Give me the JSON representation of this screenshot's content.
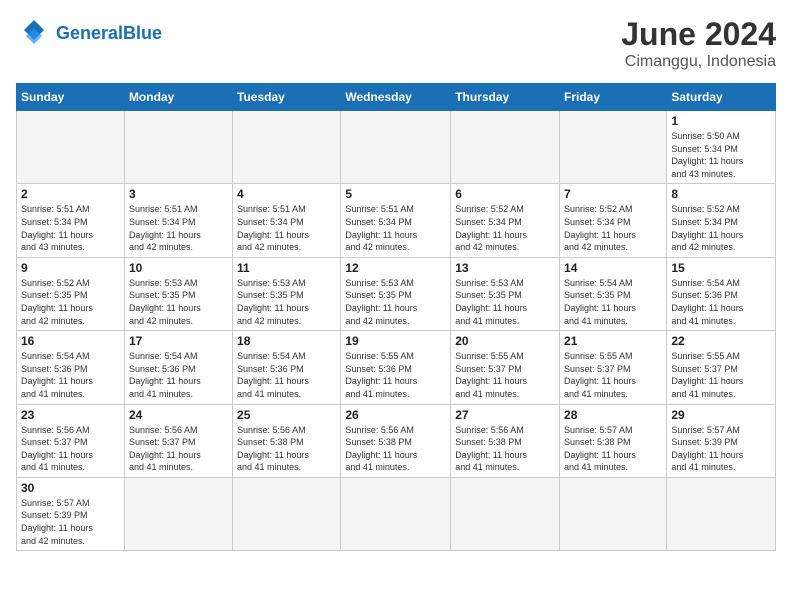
{
  "header": {
    "logo_general": "General",
    "logo_blue": "Blue",
    "title": "June 2024",
    "subtitle": "Cimanggu, Indonesia"
  },
  "weekdays": [
    "Sunday",
    "Monday",
    "Tuesday",
    "Wednesday",
    "Thursday",
    "Friday",
    "Saturday"
  ],
  "weeks": [
    [
      {
        "day": "",
        "info": ""
      },
      {
        "day": "",
        "info": ""
      },
      {
        "day": "",
        "info": ""
      },
      {
        "day": "",
        "info": ""
      },
      {
        "day": "",
        "info": ""
      },
      {
        "day": "",
        "info": ""
      },
      {
        "day": "1",
        "info": "Sunrise: 5:50 AM\nSunset: 5:34 PM\nDaylight: 11 hours\nand 43 minutes."
      }
    ],
    [
      {
        "day": "2",
        "info": "Sunrise: 5:51 AM\nSunset: 5:34 PM\nDaylight: 11 hours\nand 43 minutes."
      },
      {
        "day": "3",
        "info": "Sunrise: 5:51 AM\nSunset: 5:34 PM\nDaylight: 11 hours\nand 42 minutes."
      },
      {
        "day": "4",
        "info": "Sunrise: 5:51 AM\nSunset: 5:34 PM\nDaylight: 11 hours\nand 42 minutes."
      },
      {
        "day": "5",
        "info": "Sunrise: 5:51 AM\nSunset: 5:34 PM\nDaylight: 11 hours\nand 42 minutes."
      },
      {
        "day": "6",
        "info": "Sunrise: 5:52 AM\nSunset: 5:34 PM\nDaylight: 11 hours\nand 42 minutes."
      },
      {
        "day": "7",
        "info": "Sunrise: 5:52 AM\nSunset: 5:34 PM\nDaylight: 11 hours\nand 42 minutes."
      },
      {
        "day": "8",
        "info": "Sunrise: 5:52 AM\nSunset: 5:34 PM\nDaylight: 11 hours\nand 42 minutes."
      }
    ],
    [
      {
        "day": "9",
        "info": "Sunrise: 5:52 AM\nSunset: 5:35 PM\nDaylight: 11 hours\nand 42 minutes."
      },
      {
        "day": "10",
        "info": "Sunrise: 5:53 AM\nSunset: 5:35 PM\nDaylight: 11 hours\nand 42 minutes."
      },
      {
        "day": "11",
        "info": "Sunrise: 5:53 AM\nSunset: 5:35 PM\nDaylight: 11 hours\nand 42 minutes."
      },
      {
        "day": "12",
        "info": "Sunrise: 5:53 AM\nSunset: 5:35 PM\nDaylight: 11 hours\nand 42 minutes."
      },
      {
        "day": "13",
        "info": "Sunrise: 5:53 AM\nSunset: 5:35 PM\nDaylight: 11 hours\nand 41 minutes."
      },
      {
        "day": "14",
        "info": "Sunrise: 5:54 AM\nSunset: 5:35 PM\nDaylight: 11 hours\nand 41 minutes."
      },
      {
        "day": "15",
        "info": "Sunrise: 5:54 AM\nSunset: 5:36 PM\nDaylight: 11 hours\nand 41 minutes."
      }
    ],
    [
      {
        "day": "16",
        "info": "Sunrise: 5:54 AM\nSunset: 5:36 PM\nDaylight: 11 hours\nand 41 minutes."
      },
      {
        "day": "17",
        "info": "Sunrise: 5:54 AM\nSunset: 5:36 PM\nDaylight: 11 hours\nand 41 minutes."
      },
      {
        "day": "18",
        "info": "Sunrise: 5:54 AM\nSunset: 5:36 PM\nDaylight: 11 hours\nand 41 minutes."
      },
      {
        "day": "19",
        "info": "Sunrise: 5:55 AM\nSunset: 5:36 PM\nDaylight: 11 hours\nand 41 minutes."
      },
      {
        "day": "20",
        "info": "Sunrise: 5:55 AM\nSunset: 5:37 PM\nDaylight: 11 hours\nand 41 minutes."
      },
      {
        "day": "21",
        "info": "Sunrise: 5:55 AM\nSunset: 5:37 PM\nDaylight: 11 hours\nand 41 minutes."
      },
      {
        "day": "22",
        "info": "Sunrise: 5:55 AM\nSunset: 5:37 PM\nDaylight: 11 hours\nand 41 minutes."
      }
    ],
    [
      {
        "day": "23",
        "info": "Sunrise: 5:56 AM\nSunset: 5:37 PM\nDaylight: 11 hours\nand 41 minutes."
      },
      {
        "day": "24",
        "info": "Sunrise: 5:56 AM\nSunset: 5:37 PM\nDaylight: 11 hours\nand 41 minutes."
      },
      {
        "day": "25",
        "info": "Sunrise: 5:56 AM\nSunset: 5:38 PM\nDaylight: 11 hours\nand 41 minutes."
      },
      {
        "day": "26",
        "info": "Sunrise: 5:56 AM\nSunset: 5:38 PM\nDaylight: 11 hours\nand 41 minutes."
      },
      {
        "day": "27",
        "info": "Sunrise: 5:56 AM\nSunset: 5:38 PM\nDaylight: 11 hours\nand 41 minutes."
      },
      {
        "day": "28",
        "info": "Sunrise: 5:57 AM\nSunset: 5:38 PM\nDaylight: 11 hours\nand 41 minutes."
      },
      {
        "day": "29",
        "info": "Sunrise: 5:57 AM\nSunset: 5:39 PM\nDaylight: 11 hours\nand 41 minutes."
      }
    ],
    [
      {
        "day": "30",
        "info": "Sunrise: 5:57 AM\nSunset: 5:39 PM\nDaylight: 11 hours\nand 42 minutes."
      },
      {
        "day": "",
        "info": ""
      },
      {
        "day": "",
        "info": ""
      },
      {
        "day": "",
        "info": ""
      },
      {
        "day": "",
        "info": ""
      },
      {
        "day": "",
        "info": ""
      },
      {
        "day": "",
        "info": ""
      }
    ]
  ]
}
